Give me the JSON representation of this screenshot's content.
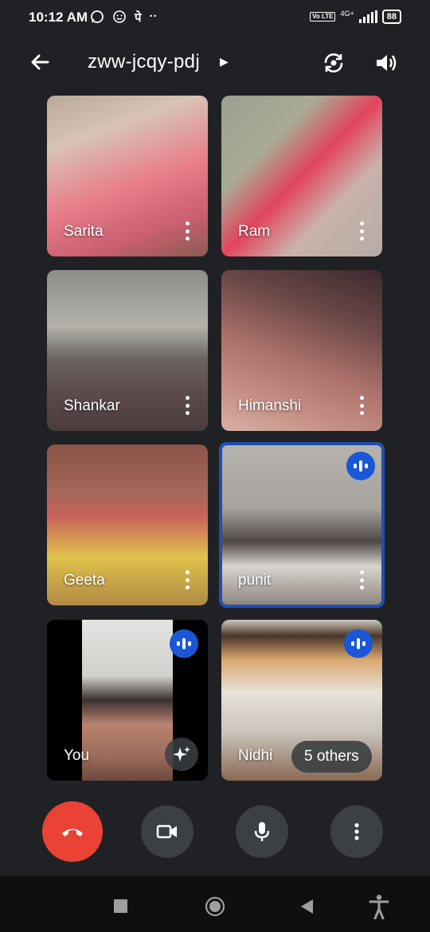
{
  "status_bar": {
    "time": "10:12 AM",
    "notif_icons": [
      "whatsapp-icon",
      "smiley-icon",
      "पे",
      "··"
    ],
    "network": "4G+",
    "volte": "Vo LTE",
    "battery": "88"
  },
  "header": {
    "meeting_code": "zww-jcqy-pdj"
  },
  "tiles": [
    {
      "name": "Sarita",
      "speaking": false
    },
    {
      "name": "Ram",
      "speaking": false
    },
    {
      "name": "Shankar",
      "speaking": false
    },
    {
      "name": "Himanshi",
      "speaking": false
    },
    {
      "name": "Geeta",
      "speaking": false
    },
    {
      "name": "punit",
      "speaking": true
    },
    {
      "name": "You",
      "speaking": true
    },
    {
      "name": "Nidhi",
      "speaking": true,
      "others_label": "5 others"
    }
  ],
  "controls": [
    "end-call",
    "camera",
    "microphone",
    "more-options"
  ],
  "colors": {
    "background": "#202124",
    "end_call": "#ea4335",
    "speaking_badge": "#1a57d6",
    "active_border": "#1f4fb4",
    "control_button": "#3c4043"
  }
}
